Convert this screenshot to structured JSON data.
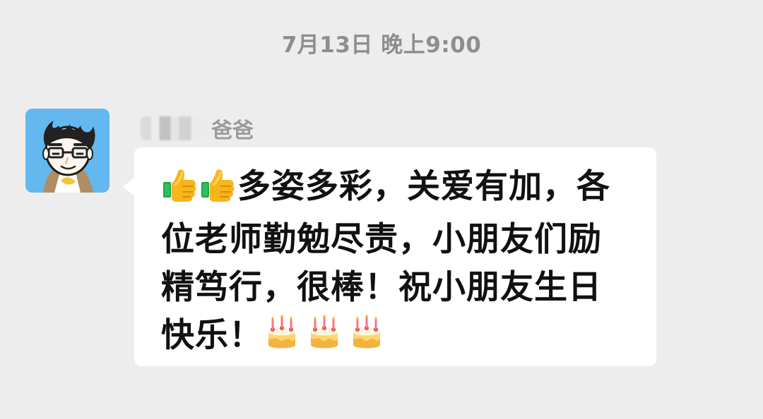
{
  "chat": {
    "timestamp": "7月13日 晚上9:00",
    "message": {
      "sender_name_visible": "爸爸",
      "text": "多姿多彩，关爱有加，各位老师勤勉尽责，小朋友们励精笃行，很棒！祝小朋友生日快乐！",
      "leading_emoji": [
        "thumbs-up-icon",
        "thumbs-up-icon"
      ],
      "trailing_emoji": [
        "birthday-cake-icon",
        "birthday-cake-icon",
        "birthday-cake-icon"
      ]
    }
  },
  "colors": {
    "background": "#ededed",
    "bubble": "#ffffff",
    "timestamp": "#8e8e8e",
    "sender_name": "#9b9b9b",
    "message_text": "#111111",
    "avatar_background": "#63b8ef"
  }
}
